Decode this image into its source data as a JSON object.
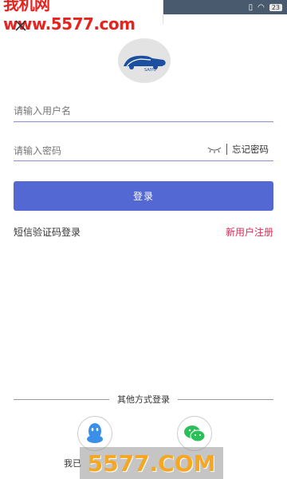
{
  "watermark": {
    "top": "我机网 www.5577.com",
    "bottom": "5577.COM"
  },
  "status": {
    "battery": "23"
  },
  "login": {
    "username_placeholder": "请输入用户名",
    "password_placeholder": "请输入密码",
    "forgot_password": "忘记密码",
    "submit_label": "登录",
    "sms_login": "短信验证码登录",
    "register": "新用户注册"
  },
  "other_login": {
    "label": "其他方式登录"
  },
  "agreement": {
    "prefix": "我已"
  },
  "colors": {
    "primary": "#5468d4",
    "register": "#e02a52",
    "wechat": "#2bbf5a",
    "qq": "#3a8fe6"
  }
}
